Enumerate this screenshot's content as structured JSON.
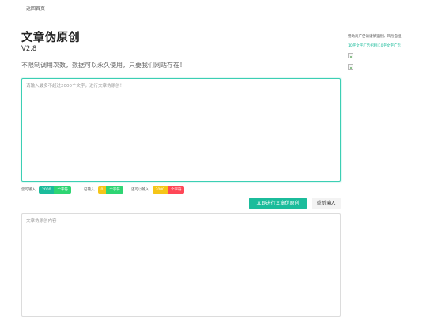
{
  "nav": {
    "back_home": "返回首页"
  },
  "header": {
    "title": "文章伪原创",
    "version": "V2.8",
    "subtitle": "不限制调用次数，数据可以永久使用，只要我们网站存在！"
  },
  "input": {
    "placeholder": "请输入最多不超过2000个文字，进行文章伪原创！",
    "value": ""
  },
  "stats": {
    "limit": {
      "label": "您可输入",
      "value": "2000",
      "unit": "个字符",
      "value_color": "#1bbc9b",
      "unit_color": "#2ed573"
    },
    "entered": {
      "label": "已输入",
      "value": "0",
      "unit": "个字符",
      "value_color": "#f5c518",
      "unit_color": "#2ed573"
    },
    "remaining": {
      "label": "还可以输入",
      "value": "2000",
      "unit": "个字符",
      "value_color": "#f5c518",
      "unit_color": "#ff4757"
    }
  },
  "buttons": {
    "run": "立即进行文章伪原创",
    "reset": "重新输入"
  },
  "output": {
    "placeholder": "文章伪原创内容",
    "value": ""
  },
  "sidebar": {
    "note": "赞助商广告请谨慎鉴别，风险自担",
    "links": [
      "10字文字广告招租",
      "10字文字广告"
    ],
    "separator": "|"
  },
  "colors": {
    "accent": "#1bbc9b",
    "focus_border": "#3ccfb4"
  }
}
